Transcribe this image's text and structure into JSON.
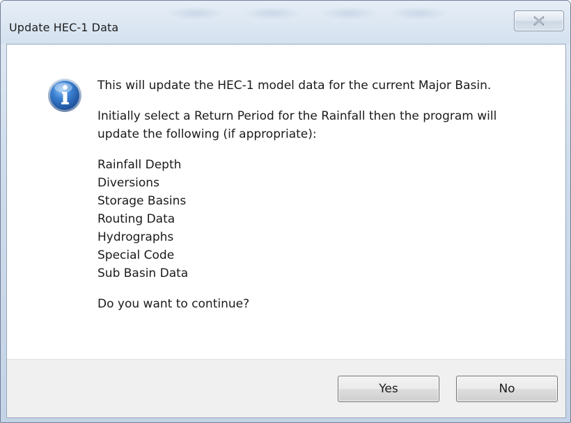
{
  "window": {
    "title": "Update HEC-1 Data"
  },
  "dialog": {
    "icon": "info-icon",
    "message_line1": "This will update the HEC-1 model data for the current Major Basin.",
    "message_line2a": "Initially select a Return Period for the Rainfall then the program will",
    "message_line2b": "update the following (if appropriate):",
    "items": [
      "Rainfall Depth",
      "Diversions",
      "Storage Basins",
      "Routing Data",
      "Hydrographs",
      "Special Code",
      "Sub Basin Data"
    ],
    "question": "Do you want to continue?"
  },
  "buttons": {
    "yes_label": "Yes",
    "no_label": "No"
  },
  "colors": {
    "icon_blue": "#2c6fc2",
    "footer_bg": "#f0f0f0",
    "title_bar": "#d4e1ef"
  }
}
